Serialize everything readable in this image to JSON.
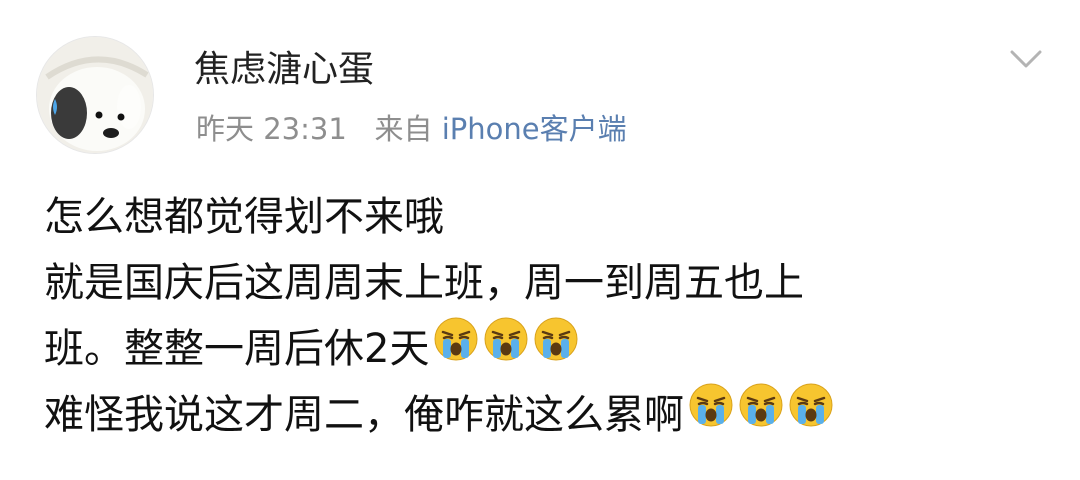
{
  "post": {
    "username": "焦虑溏心蛋",
    "time": "昨天 23:31",
    "via_prefix": "来自",
    "source": "iPhone客户端",
    "lines": [
      {
        "text": "怎么想都觉得划不来哦",
        "emoji_count": 0
      },
      {
        "text": "就是国庆后这周周末上班，周一到周五也上",
        "emoji_count": 0
      },
      {
        "text": "班。整整一周后休2天",
        "emoji_count": 3
      },
      {
        "text": "难怪我说这才周二，俺咋就这么累啊",
        "emoji_count": 3
      }
    ]
  },
  "icons": {
    "avatar": "cartoon-dog-sweat-avatar",
    "menu": "chevron-down-icon",
    "emoji": "crying-face-emoji"
  },
  "colors": {
    "meta": "#8e8e8e",
    "source": "#5a7fb0",
    "emoji_face": "#f7c52f",
    "emoji_tears": "#5ab0ea"
  }
}
